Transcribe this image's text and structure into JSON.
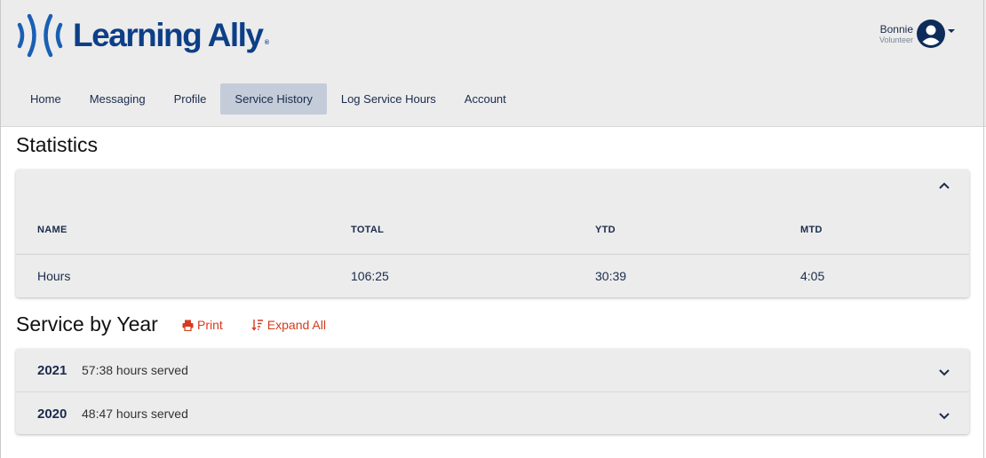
{
  "brand": {
    "name": "Learning Ally",
    "reg_mark": "®",
    "color": "#0d3f87"
  },
  "user": {
    "name": "Bonnie",
    "role": "Volunteer"
  },
  "nav": {
    "tabs": [
      {
        "label": "Home",
        "active": false
      },
      {
        "label": "Messaging",
        "active": false
      },
      {
        "label": "Profile",
        "active": false
      },
      {
        "label": "Service History",
        "active": true
      },
      {
        "label": "Log Service Hours",
        "active": false
      },
      {
        "label": "Account",
        "active": false
      }
    ]
  },
  "statistics": {
    "title": "Statistics",
    "collapse_icon": "chevron-up-icon",
    "columns": [
      "NAME",
      "TOTAL",
      "YTD",
      "MTD"
    ],
    "rows": [
      {
        "name": "Hours",
        "total": "106:25",
        "ytd": "30:39",
        "mtd": "4:05"
      }
    ]
  },
  "service_by_year": {
    "title": "Service by Year",
    "print_label": "Print",
    "expand_all_label": "Expand All",
    "accent_color": "#d63a1e",
    "years": [
      {
        "year": "2021",
        "hours": "57:38 hours served"
      },
      {
        "year": "2020",
        "hours": "48:47 hours served"
      }
    ]
  }
}
